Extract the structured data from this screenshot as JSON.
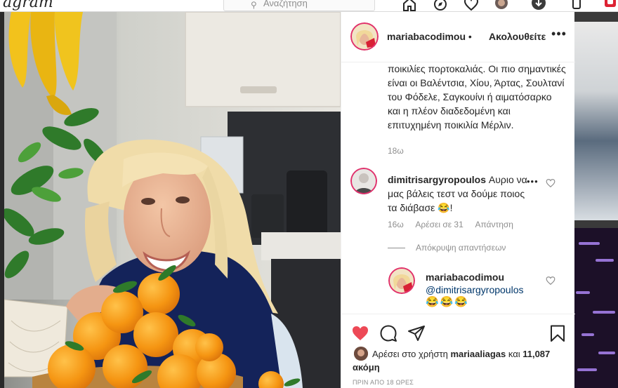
{
  "topbar": {
    "logo": "agram",
    "search_placeholder": "Αναζήτηση"
  },
  "post": {
    "author": "mariabacodimou",
    "separator": "•",
    "follow_label": "Ακολουθείτε",
    "caption": "ποικιλίες πορτοκαλιάς. Οι πιο σημαντικές είναι οι Βαλέντσια, Χίου, Άρτας, Σουλτανί του Φόδελε, Σαγκουίνι ή αιματόσαρκο και η πλέον διαδεδομένη και επιτυχημένη ποικιλία Μέρλιν.",
    "caption_age": "18ω"
  },
  "comments": {
    "c1": {
      "user": "dimitrisargyropoulos",
      "text": "Αυριο να μας βάλεις τεστ να δούμε ποιος τα διάβασε 😂!",
      "age": "16ω",
      "likes": "Αρέσει σε 31",
      "reply_label": "Απάντηση"
    },
    "hide_replies": "Απόκρυψη απαντήσεων",
    "c2": {
      "user": "mariabacodimou",
      "mention": "@dimitrisargyropoulos",
      "emojis": "😂😂😂"
    }
  },
  "likes": {
    "prefix": "Αρέσει στο χρήστη ",
    "user": "mariaaliagas",
    "joiner": " και",
    "count": "11,087 ακόμη"
  },
  "post_time": "ΠΡΙΝ ΑΠΟ 18 ΩΡΕΣ",
  "colors": {
    "heart_liked": "#ed4956",
    "text": "#262626",
    "muted": "#8e8e8e",
    "link": "#00376b"
  }
}
